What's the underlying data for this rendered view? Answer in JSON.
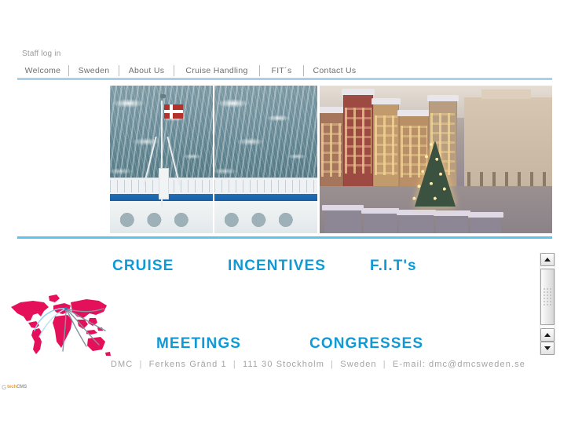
{
  "site": {
    "name": "DMC Sweden",
    "accent_blue": "#0f9ad6",
    "nav_rule_blue": "#a7d2ea",
    "divider_blue": "#5bc3ec",
    "map_red": "#e5105a"
  },
  "topbar": {
    "staff_login_label": "Staff log in"
  },
  "nav": {
    "items": [
      {
        "label": "Welcome"
      },
      {
        "label": "Sweden"
      },
      {
        "label": "About Us"
      },
      {
        "label": "Cruise Handling"
      },
      {
        "label": "FIT´s"
      },
      {
        "label": "Contact Us"
      }
    ]
  },
  "hero": {
    "images": [
      {
        "alt": "cruise-ship-stern-with-danish-flag-left-half"
      },
      {
        "alt": "cruise-ship-stern-with-danish-flag-right-half"
      },
      {
        "alt": "stockholm-old-town-christmas-market-at-dusk"
      }
    ]
  },
  "services": [
    {
      "id": "cruise",
      "label": "CRUISE"
    },
    {
      "id": "incentives",
      "label": "INCENTIVES"
    },
    {
      "id": "fits",
      "label": "F.I.T's"
    },
    {
      "id": "meetings",
      "label": "MEETINGS"
    },
    {
      "id": "congresses",
      "label": "CONGRESSES"
    }
  ],
  "worldmap": {
    "alt": "world-map-with-travel-routes-from-europe"
  },
  "footer": {
    "company": "DMC",
    "street": "Ferkens Gränd 1",
    "postal_city": "111 30 Stockholm",
    "country": "Sweden",
    "email_line": "E-mail: dmc@dmcsweden.se",
    "separator": "|"
  },
  "cms_badge": {
    "mark": "G",
    "tech": "tech",
    "cms": "CMS"
  },
  "scrollbar": {
    "up_arrow": "▲",
    "down_arrow": "▼"
  }
}
